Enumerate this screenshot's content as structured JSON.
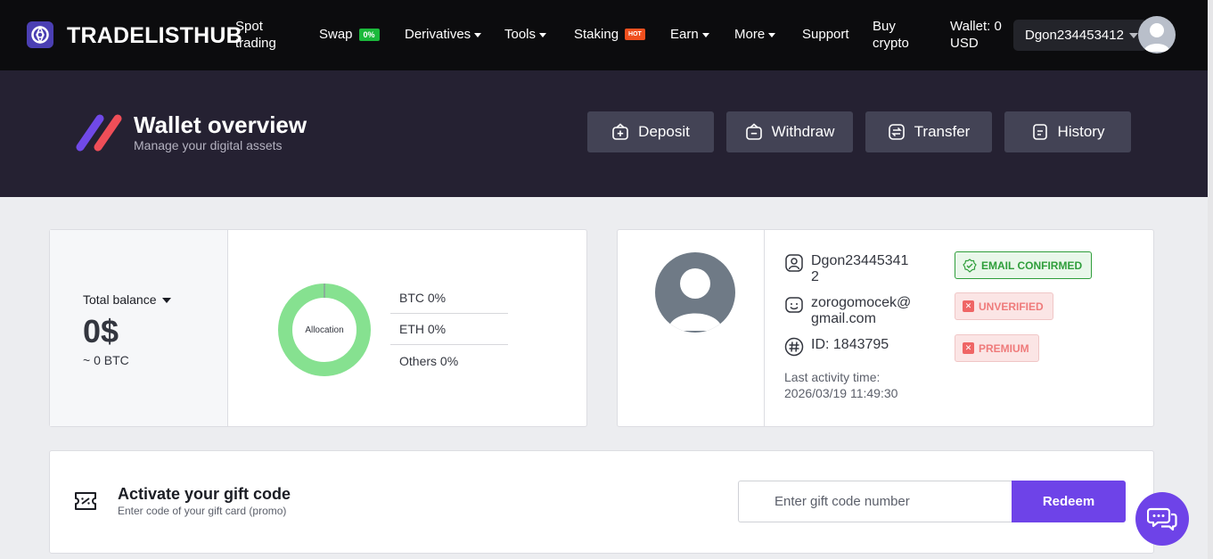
{
  "nav": {
    "brand": "TRADELISTHUB",
    "spot_line1": "Spot",
    "spot_line2": "trading",
    "swap": "Swap",
    "swap_badge": "0%",
    "derivatives": "Derivatives",
    "tools": "Tools",
    "staking": "Staking",
    "staking_badge": "HOT",
    "earn": "Earn",
    "more": "More",
    "support": "Support",
    "buy_line1": "Buy",
    "buy_line2": "crypto",
    "wallet_line1": "Wallet: 0",
    "wallet_line2": "USD",
    "username": "Dgon234453412"
  },
  "hero": {
    "title": "Wallet overview",
    "subtitle": "Manage your digital assets",
    "buttons": [
      "Deposit",
      "Withdraw",
      "Transfer",
      "History"
    ]
  },
  "balance": {
    "label": "Total balance",
    "value": "0$",
    "btc": "~ 0 BTC",
    "donut_label": "Allocation",
    "legend": [
      "BTC 0%",
      "ETH 0%",
      "Others 0%"
    ]
  },
  "chart_data": {
    "type": "pie",
    "categories": [
      "BTC",
      "ETH",
      "Others"
    ],
    "values": [
      0,
      0,
      0
    ],
    "title": "Allocation"
  },
  "profile": {
    "username_line1": "Dgon23445341",
    "username_line2": "2",
    "email_line1": "zorogomocek@",
    "email_line2": "gmail.com",
    "id": "ID: 1843795",
    "activity_label": "Last activity time:",
    "activity_time": "2026/03/19 11:49:30",
    "statuses": {
      "email": "EMAIL CONFIRMED",
      "verified": "UNVERIFIED",
      "premium": "PREMIUM"
    }
  },
  "gift": {
    "title": "Activate your gift code",
    "subtitle": "Enter code of your gift card (promo)",
    "placeholder": "Enter gift code number",
    "button": "Redeem"
  },
  "colors": {
    "accent": "#6e43e8",
    "hero_bg": "#252132",
    "donut": "#86e190",
    "success": "#2f9e3b",
    "danger": "#ef6565"
  }
}
